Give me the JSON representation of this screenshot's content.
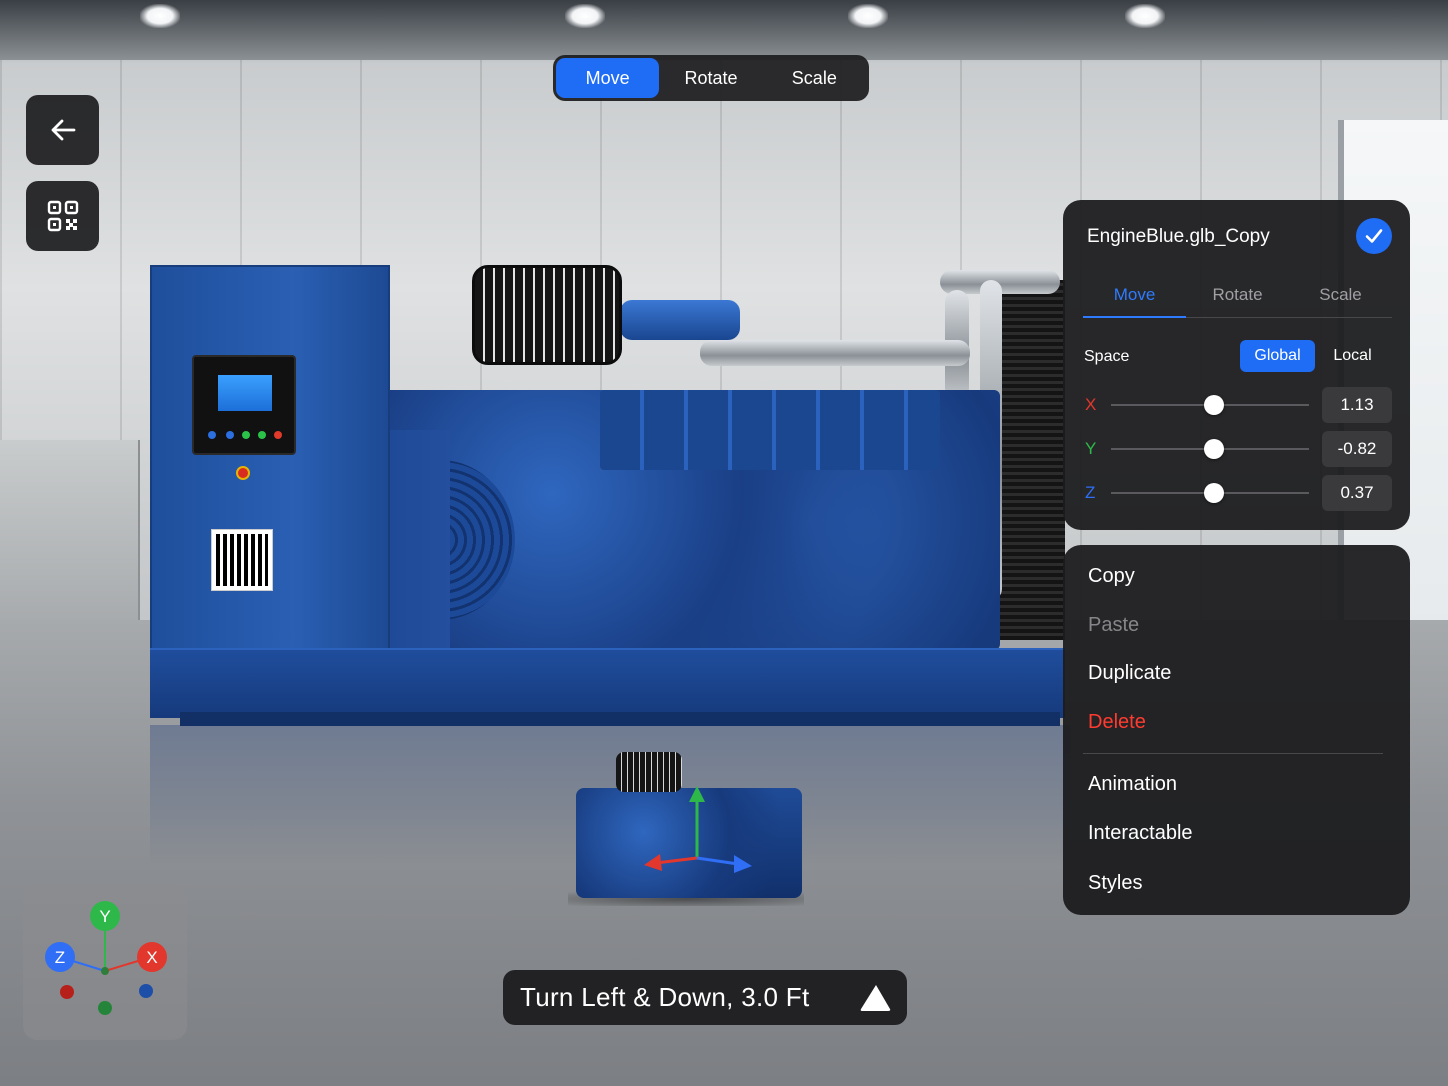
{
  "toolbar": {
    "modes": [
      "Move",
      "Rotate",
      "Scale"
    ],
    "active_mode": "Move"
  },
  "side_buttons": {
    "back_icon": "arrow-left-icon",
    "qr_icon": "qr-code-icon"
  },
  "transform_panel": {
    "title": "EngineBlue.glb_Copy",
    "confirm_icon": "checkmark-icon",
    "tabs": [
      "Move",
      "Rotate",
      "Scale"
    ],
    "active_tab": "Move",
    "space_label": "Space",
    "space_options": [
      "Global",
      "Local"
    ],
    "active_space": "Global",
    "axes": [
      {
        "label": "X",
        "value": "1.13",
        "color": "#e2372c",
        "slider_fraction": 0.52
      },
      {
        "label": "Y",
        "value": "-0.82",
        "color": "#2fb84a",
        "slider_fraction": 0.52
      },
      {
        "label": "Z",
        "value": "0.37",
        "color": "#2f6ef5",
        "slider_fraction": 0.52
      }
    ]
  },
  "context_menu": {
    "items": [
      {
        "label": "Copy",
        "state": "enabled"
      },
      {
        "label": "Paste",
        "state": "disabled"
      },
      {
        "label": "Duplicate",
        "state": "enabled"
      },
      {
        "label": "Delete",
        "state": "destructive"
      }
    ],
    "secondary_items": [
      {
        "label": "Animation"
      },
      {
        "label": "Interactable"
      },
      {
        "label": "Styles"
      }
    ]
  },
  "hint": {
    "text": "Turn Left & Down, 3.0 Ft",
    "icon": "direction-arrow-icon"
  },
  "axis_widget": {
    "labels": [
      "Y",
      "Z",
      "X"
    ],
    "colors": {
      "x": "#e2372c",
      "y": "#2fb84a",
      "z": "#2f6ef5"
    }
  },
  "colors": {
    "accent": "#1f6cf5",
    "destructive": "#ff3b30",
    "panel_bg": "#1c1c1e"
  }
}
